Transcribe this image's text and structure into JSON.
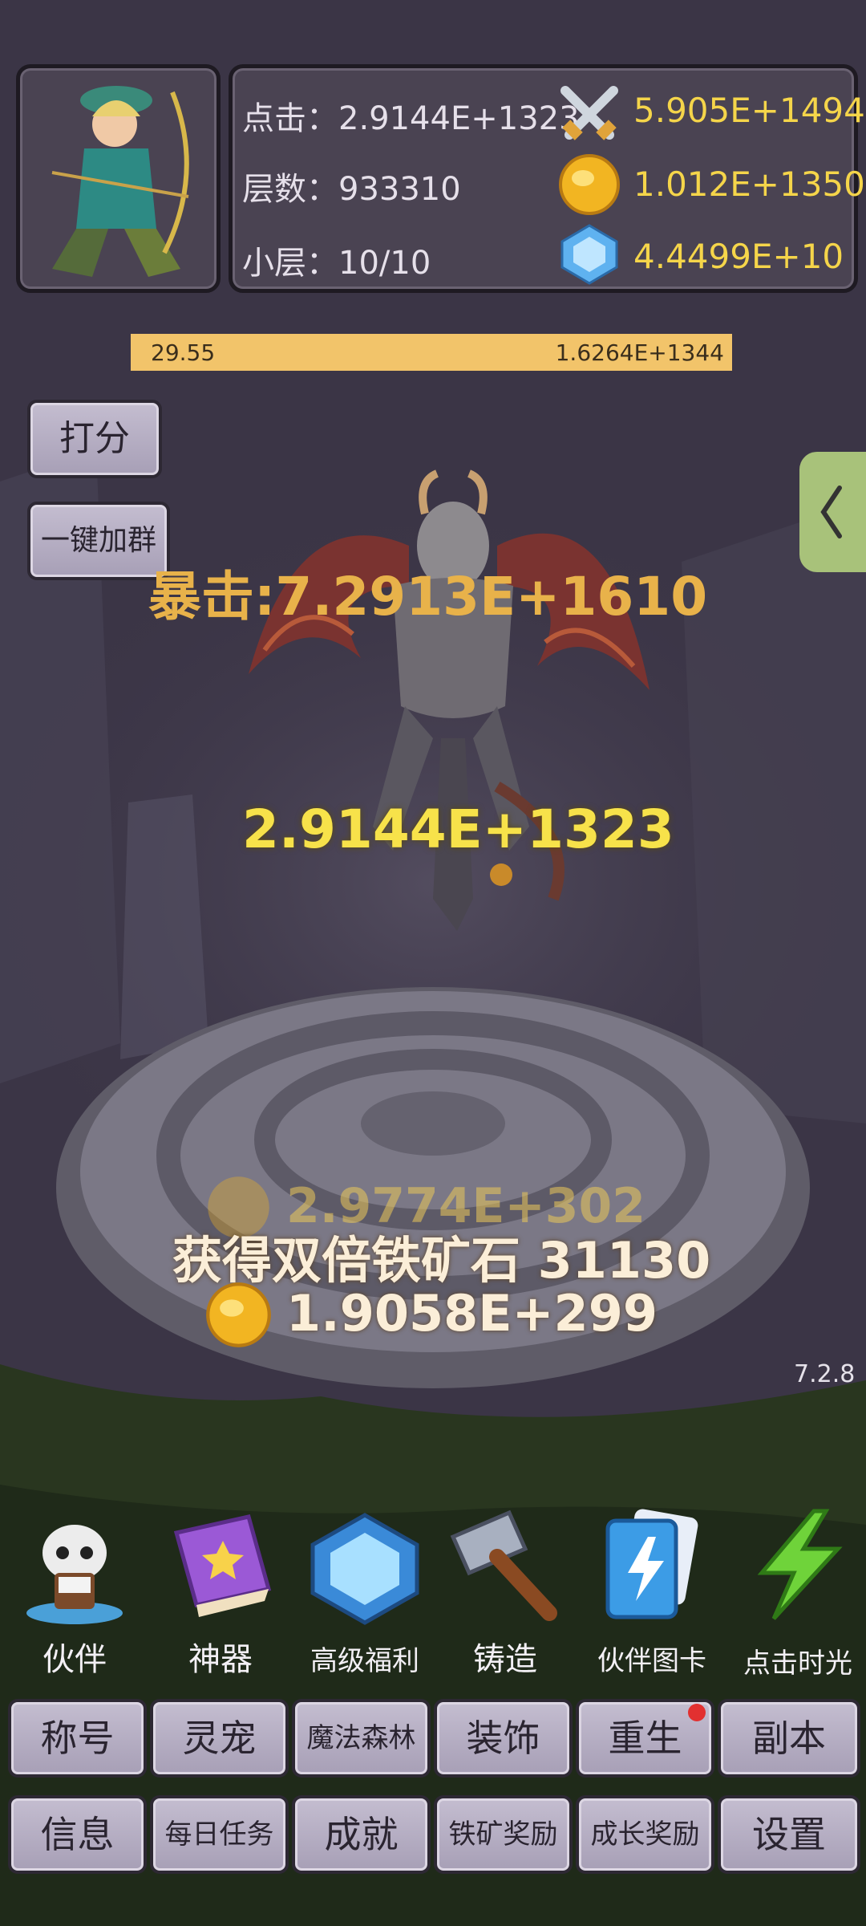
{
  "header": {
    "click_label": "点击：2.9144E+1323",
    "floor_label": "层数：933310",
    "sublevel_label": "小层：10/10",
    "attack_value": "5.905E+1494",
    "gold_value": "1.012E+1350",
    "gem_value": "4.4499E+10"
  },
  "progress": {
    "left_value": "29.55",
    "right_value": "1.6264E+1344",
    "fill": 1.0
  },
  "side_buttons": {
    "rate": "打分",
    "join_group": "一键加群"
  },
  "floating": {
    "crit": "暴击:7.2913E+1610",
    "damage": "2.9144E+1323",
    "gold_faded": "2.9774E+302",
    "iron_ore": "获得双倍铁矿石 31130",
    "gold_gain": "1.9058E+299"
  },
  "version": "7.2.8",
  "menu": [
    {
      "label": "伙伴",
      "icon": "skull-partner-icon"
    },
    {
      "label": "神器",
      "icon": "artifact-book-icon"
    },
    {
      "label": "高级福利",
      "icon": "diamond-icon"
    },
    {
      "label": "铸造",
      "icon": "hammer-icon"
    },
    {
      "label": "伙伴图卡",
      "icon": "cards-icon"
    },
    {
      "label": "点击时光",
      "icon": "lightning-icon"
    }
  ],
  "row1": [
    "称号",
    "灵宠",
    "魔法森林",
    "装饰",
    "重生",
    "副本"
  ],
  "row2": [
    "信息",
    "每日任务",
    "成就",
    "铁矿奖励",
    "成长奖励",
    "设置"
  ],
  "colors": {
    "gold": "#f5d54a",
    "progress": "#f2c46a",
    "side_tab": "#a8c27a"
  }
}
